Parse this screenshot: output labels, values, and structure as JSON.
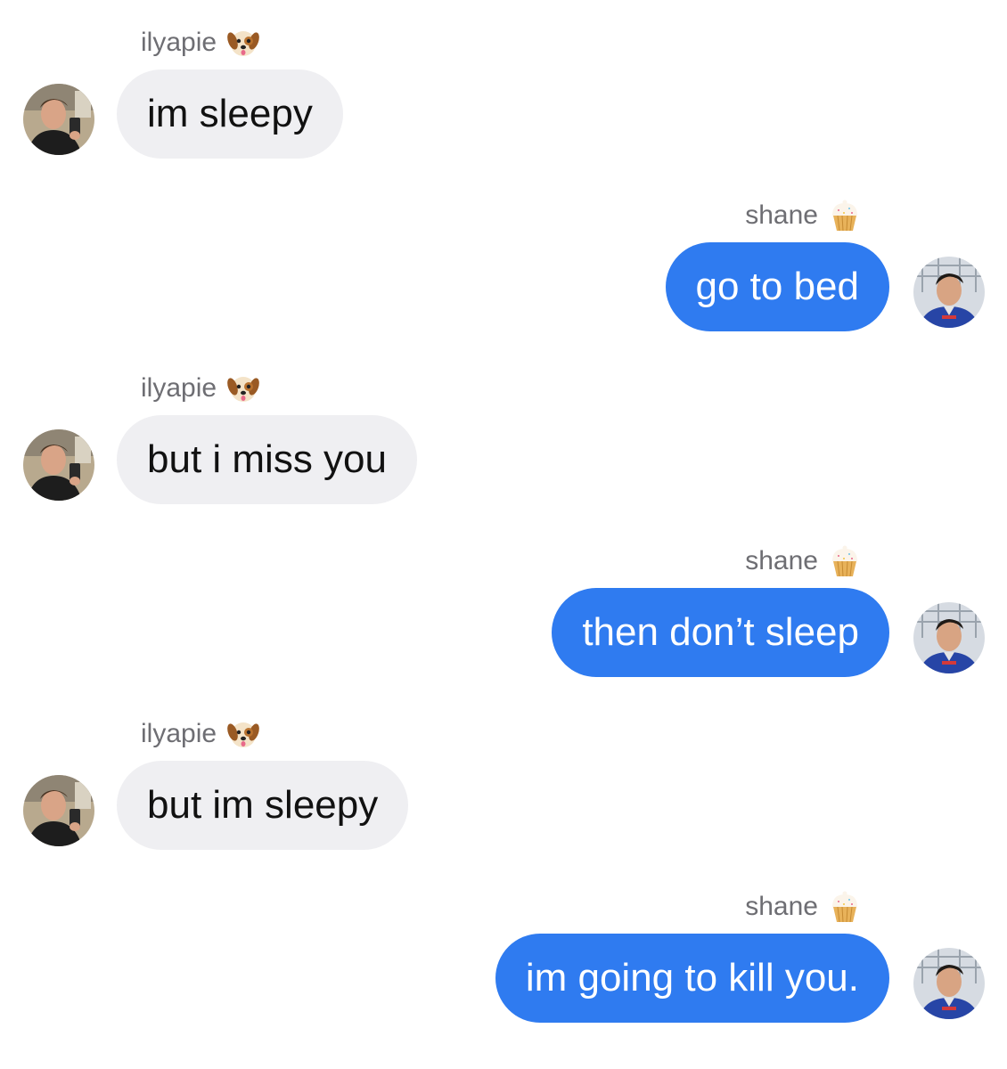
{
  "messages": [
    {
      "sender": "ilyapie",
      "sender_emoji": "dog-face-emoji",
      "text": "im sleepy",
      "side": "left"
    },
    {
      "sender": "shane",
      "sender_emoji": "cupcake-emoji",
      "text": "go to bed",
      "side": "right"
    },
    {
      "sender": "ilyapie",
      "sender_emoji": "dog-face-emoji",
      "text": "but i miss you",
      "side": "left"
    },
    {
      "sender": "shane",
      "sender_emoji": "cupcake-emoji",
      "text": "then don’t sleep",
      "side": "right"
    },
    {
      "sender": "ilyapie",
      "sender_emoji": "dog-face-emoji",
      "text": "but im sleepy",
      "side": "left"
    },
    {
      "sender": "shane",
      "sender_emoji": "cupcake-emoji",
      "text": "im going to kill you.",
      "side": "right"
    }
  ],
  "colors": {
    "incoming_bubble": "#efeff2",
    "outgoing_bubble": "#2f7bf0",
    "sender_label": "#6e6e73"
  }
}
